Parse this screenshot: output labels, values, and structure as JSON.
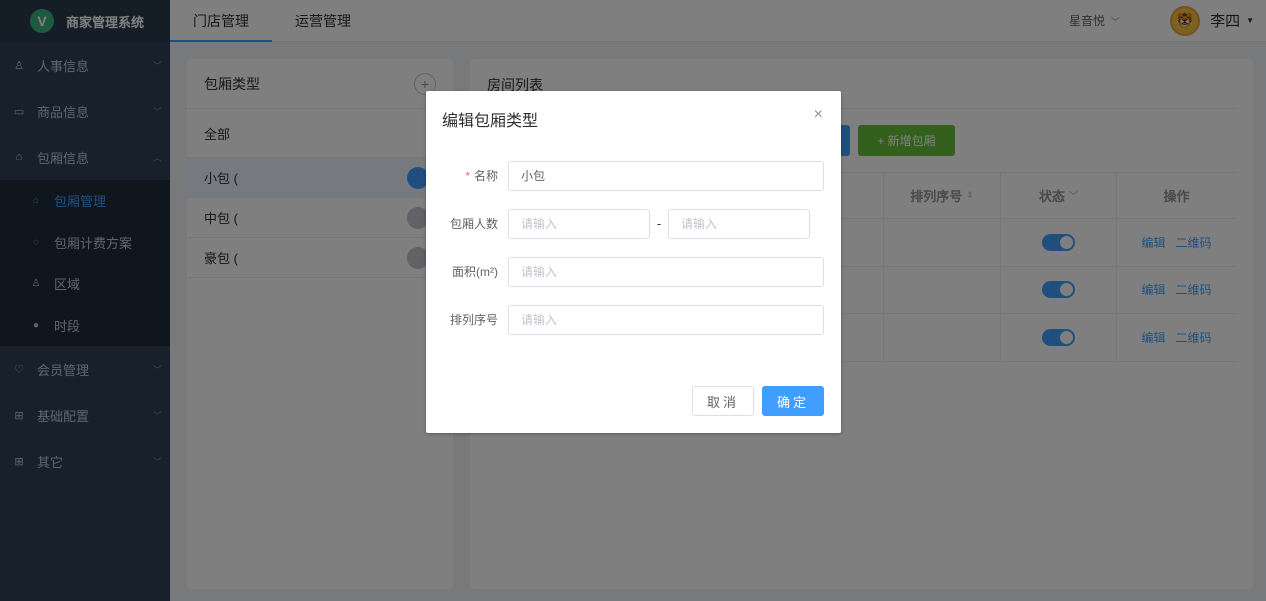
{
  "app": {
    "logo_letter": "V",
    "name": "商家管理系统"
  },
  "sidebar": {
    "items": [
      {
        "icon": "user-icon",
        "glyph": "♙",
        "label": "人事信息"
      },
      {
        "icon": "goods-icon",
        "glyph": "▭",
        "label": "商品信息"
      },
      {
        "icon": "room-icon",
        "glyph": "⌂",
        "label": "包厢信息"
      }
    ],
    "sub_items": [
      {
        "icon": "room-manage-icon",
        "glyph": "⌂",
        "label": "包厢管理",
        "active": true
      },
      {
        "icon": "billing-icon",
        "glyph": "◌",
        "label": "包厢计费方案"
      },
      {
        "icon": "area-icon",
        "glyph": "♙",
        "label": "区域"
      },
      {
        "icon": "clock-icon",
        "glyph": "●",
        "label": "时段"
      }
    ],
    "items_after": [
      {
        "icon": "member-icon",
        "glyph": "♡",
        "label": "会员管理"
      },
      {
        "icon": "config-icon",
        "glyph": "⊞",
        "label": "基础配置"
      },
      {
        "icon": "other-icon",
        "glyph": "⊞",
        "label": "其它"
      }
    ]
  },
  "topbar": {
    "tabs": [
      {
        "label": "门店管理",
        "active": true
      },
      {
        "label": "运营管理"
      }
    ],
    "store": "星音悦",
    "user": "李四"
  },
  "room_types": {
    "title": "包厢类型",
    "items": [
      "全部",
      "小包 (",
      "中包 (",
      "豪包 ("
    ]
  },
  "room_list": {
    "title": "房间列表",
    "add_button": "新增包厢",
    "columns": {
      "sort_no": "排列序号",
      "status": "状态",
      "actions": "操作"
    },
    "row_actions": {
      "edit": "编辑",
      "qrcode": "二维码"
    }
  },
  "dialog": {
    "title": "编辑包厢类型",
    "fields": {
      "name_label": "名称",
      "name_value": "小包",
      "people_label": "包厢人数",
      "people_min_placeholder": "请输入",
      "people_max_placeholder": "请输入",
      "people_separator": "-",
      "area_label": "面积(m²)",
      "area_placeholder": "请输入",
      "sort_label": "排列序号",
      "sort_placeholder": "请输入"
    },
    "cancel": "取消",
    "confirm": "确定"
  }
}
